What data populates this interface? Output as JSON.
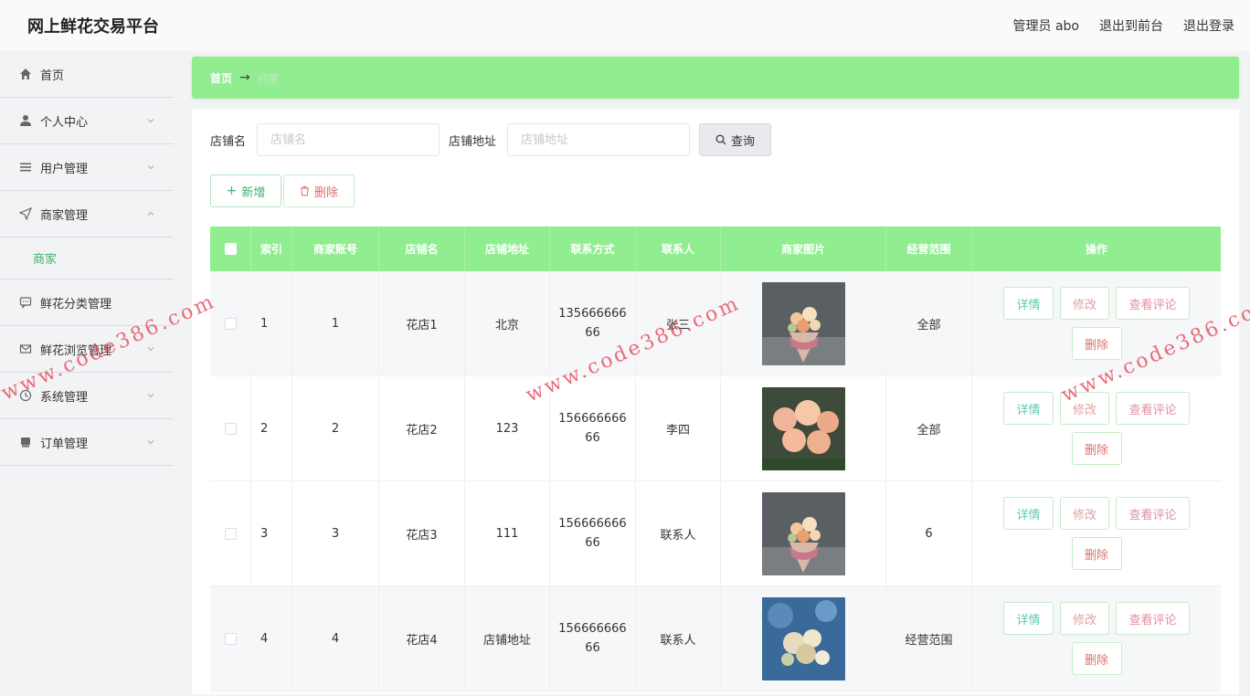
{
  "app": {
    "title": "网上鲜花交易平台"
  },
  "top_links": {
    "admin": "管理员 abo",
    "to_front": "退出到前台",
    "logout": "退出登录"
  },
  "sidebar": {
    "items": [
      {
        "label": "首页",
        "icon": "home-icon"
      },
      {
        "label": "个人中心",
        "icon": "user-icon"
      },
      {
        "label": "用户管理",
        "icon": "list-icon"
      },
      {
        "label": "商家管理",
        "icon": "send-icon",
        "expanded": true,
        "children": [
          {
            "label": "商家"
          }
        ]
      },
      {
        "label": "鲜花分类管理",
        "icon": "chat-icon"
      },
      {
        "label": "鲜花浏览管理",
        "icon": "mail-icon"
      },
      {
        "label": "系统管理",
        "icon": "clock-icon"
      },
      {
        "label": "订单管理",
        "icon": "cart-icon"
      }
    ]
  },
  "breadcrumb": {
    "home": "首页",
    "arrow": "→",
    "current": "商家"
  },
  "search": {
    "shop_name_label": "店铺名",
    "shop_name_placeholder": "店铺名",
    "shop_addr_label": "店铺地址",
    "shop_addr_placeholder": "店铺地址",
    "query_label": "查询"
  },
  "actions": {
    "add_label": "新增",
    "delete_label": "删除"
  },
  "table": {
    "headers": [
      "索引",
      "商家账号",
      "店铺名",
      "店铺地址",
      "联系方式",
      "联系人",
      "商家图片",
      "经营范围",
      "操作"
    ],
    "rows": [
      {
        "index": "1",
        "account": "1",
        "shop_name": "花店1",
        "address": "北京",
        "phone": "13566666666",
        "contact": "张三",
        "scope": "全部"
      },
      {
        "index": "2",
        "account": "2",
        "shop_name": "花店2",
        "address": "123",
        "phone": "15666666666",
        "contact": "李四",
        "scope": "全部"
      },
      {
        "index": "3",
        "account": "3",
        "shop_name": "花店3",
        "address": "111",
        "phone": "15666666666",
        "contact": "联系人",
        "scope": "6"
      },
      {
        "index": "4",
        "account": "4",
        "shop_name": "花店4",
        "address": "店铺地址",
        "phone": "15666666666",
        "contact": "联系人",
        "scope": "经营范围"
      }
    ],
    "op_labels": {
      "detail": "详情",
      "edit": "修改",
      "review": "查看评论",
      "delete": "删除"
    }
  },
  "watermark": "www.code386.com",
  "colors": {
    "accent": "#90ee90",
    "active_menu": "#3cb371",
    "watermark": "#e63c50"
  }
}
